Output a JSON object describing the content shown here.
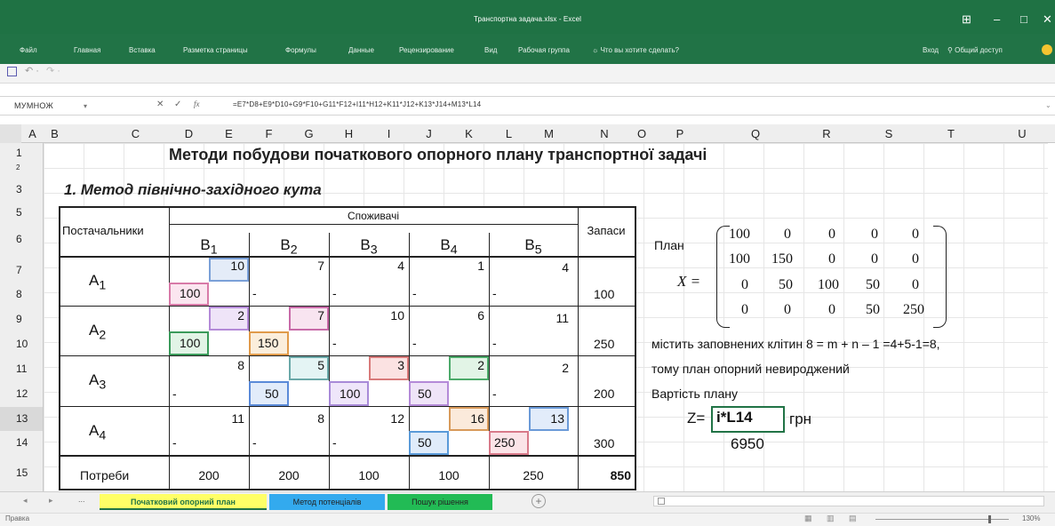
{
  "app": {
    "title": "Транспортна задача.xlsx - Excel",
    "controls": [
      "⊞",
      "–",
      "□",
      "✕"
    ]
  },
  "ribbon": {
    "tabs": [
      "Файл",
      "Главная",
      "Вставка",
      "Разметка страницы",
      "Формулы",
      "Данные",
      "Рецензирование",
      "Вид",
      "Рабочая группа",
      "Что вы хотите сделать?"
    ],
    "signin": "Вход",
    "share": "Общий доступ"
  },
  "formula_bar": {
    "name_box": "МУМНОЖ",
    "cancel": "✕",
    "confirm": "✓",
    "fx": "fx",
    "formula": "=E7*D8+E9*D10+G9*F10+G11*F12+I11*H12+K11*J12+K13*J14+M13*L14"
  },
  "columns": [
    "A",
    "B",
    "C",
    "D",
    "E",
    "F",
    "G",
    "H",
    "I",
    "J",
    "K",
    "L",
    "M",
    "N",
    "O",
    "P",
    "Q",
    "R",
    "S",
    "T",
    "U"
  ],
  "rows": [
    "1",
    "2",
    "3",
    "5",
    "6",
    "7",
    "8",
    "9",
    "10",
    "11",
    "12",
    "13",
    "14",
    "15"
  ],
  "sheet": {
    "title": "Методи побудови початкового опорного плану транспортної задачі",
    "section": "1. Метод північно-західного кута",
    "suppliers_header": "Постачальники",
    "consumers_header": "Споживачі",
    "stock_header": "Запаси",
    "demand_label": "Потреби",
    "consumers": [
      {
        "name": "B",
        "sub": "1"
      },
      {
        "name": "B",
        "sub": "2"
      },
      {
        "name": "B",
        "sub": "3"
      },
      {
        "name": "B",
        "sub": "4"
      },
      {
        "name": "B",
        "sub": "5"
      }
    ],
    "suppliers": [
      {
        "name": "A",
        "sub": "1"
      },
      {
        "name": "A",
        "sub": "2"
      },
      {
        "name": "A",
        "sub": "3"
      },
      {
        "name": "A",
        "sub": "4"
      }
    ],
    "costs": [
      [
        "10",
        "7",
        "4",
        "1",
        "4"
      ],
      [
        "2",
        "7",
        "10",
        "6",
        "11"
      ],
      [
        "8",
        "5",
        "3",
        "2",
        "2"
      ],
      [
        "11",
        "8",
        "12",
        "16",
        "13"
      ]
    ],
    "alloc": [
      [
        "100",
        "-",
        "-",
        "-",
        "-"
      ],
      [
        "100",
        "150",
        "-",
        "-",
        "-"
      ],
      [
        "-",
        "50",
        "100",
        "50",
        "-"
      ],
      [
        "-",
        "-",
        "-",
        "50",
        "250"
      ]
    ],
    "stocks": [
      "100",
      "250",
      "200",
      "300"
    ],
    "demand": [
      "200",
      "200",
      "100",
      "100",
      "250"
    ],
    "total": "850"
  },
  "plan": {
    "label": "План",
    "x_label": "X =",
    "matrix": [
      [
        "100",
        "0",
        "0",
        "0",
        "0"
      ],
      [
        "100",
        "150",
        "0",
        "0",
        "0"
      ],
      [
        "0",
        "50",
        "100",
        "50",
        "0"
      ],
      [
        "0",
        "0",
        "0",
        "50",
        "250"
      ]
    ],
    "text1": "містить заповнених клітин 8 = m + n – 1 =4+5-1=8,",
    "text2": "тому план опорний невироджений",
    "cost_label": "Вартість плану",
    "z_label": "Z=",
    "z_cell": "i*L14",
    "currency": "грн",
    "value": "6950"
  },
  "sheets": [
    {
      "name": "Початковий опорний план",
      "color": "#ffff66"
    },
    {
      "name": "Метод потенціалів",
      "color": "#33aaee"
    },
    {
      "name": "Пошук рішення",
      "color": "#22bb55"
    }
  ],
  "status": {
    "mode": "Правка",
    "zoom": "130%"
  }
}
